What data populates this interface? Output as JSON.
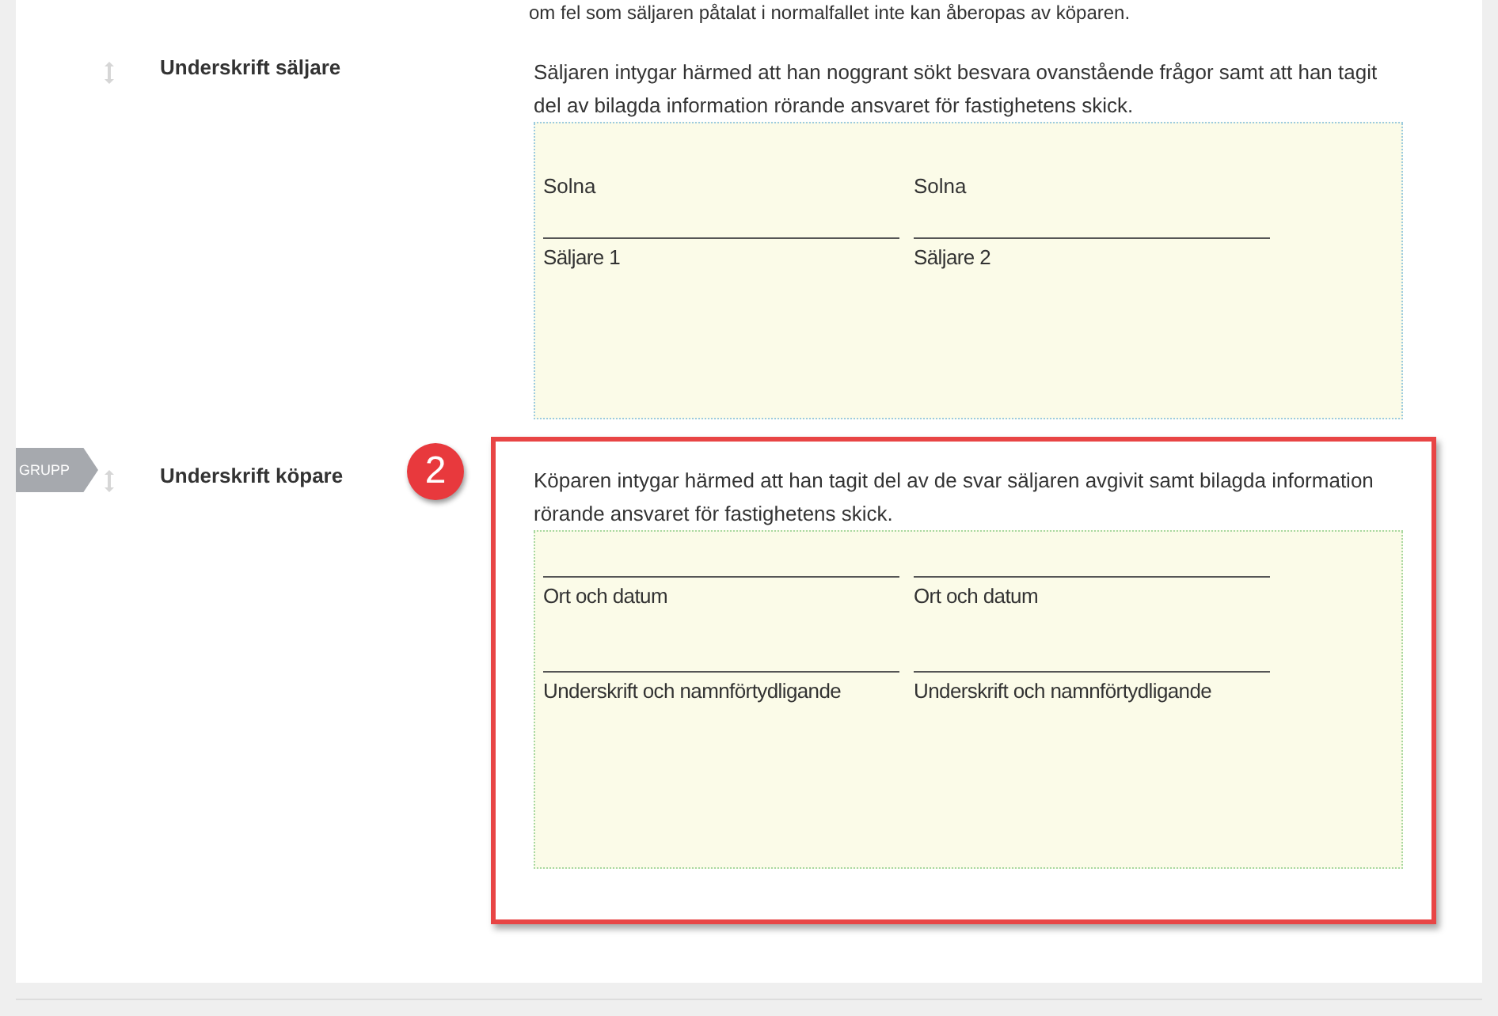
{
  "top_text": "om fel som säljaren påtalat i normalfallet inte kan åberopas av köparen.",
  "rows": [
    {
      "label": "Underskrift säljare",
      "text": "Säljaren intygar härmed att han noggrant sökt besvara ovanstående frågor samt att han tagit del av bilagda information rörande ansvaret för fastighetens skick.",
      "blocks": [
        {
          "cells": [
            {
              "value": "Solna",
              "caption": "Säljare 1"
            },
            {
              "value": "Solna",
              "caption": "Säljare 2"
            }
          ]
        }
      ]
    },
    {
      "label": "Underskrift köpare",
      "text": "Köparen intygar härmed att han tagit del av de svar säljaren avgivit samt bilagda information rörande ansvaret för fastighetens skick.",
      "blocks": [
        {
          "cells": [
            {
              "caption": "Ort och datum"
            },
            {
              "caption": "Ort och datum"
            }
          ]
        },
        {
          "cells": [
            {
              "caption": "Underskrift och namnförtydligande"
            },
            {
              "caption": "Underskrift och namnförtydligande"
            }
          ]
        }
      ],
      "highlighted": true,
      "badge": "2",
      "tag": "GRUPP"
    }
  ]
}
